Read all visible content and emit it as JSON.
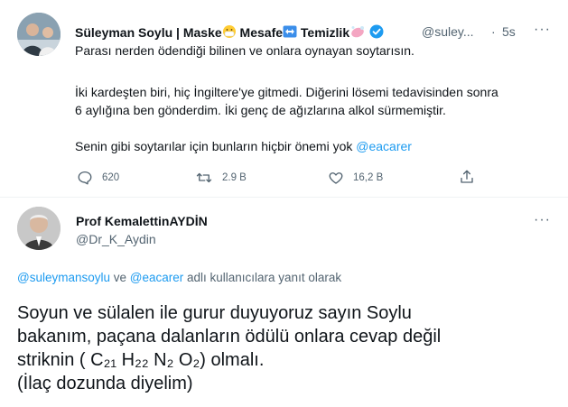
{
  "tweet1": {
    "name_part1": "Süleyman Soylu | Maske",
    "name_part2": "Mesafe",
    "name_part3": "Temizlik",
    "handle": "@suley...",
    "dot": "·",
    "time": "5s",
    "more": "···",
    "line1": "Parası nerden ödendiği bilinen ve onlara oynayan soytarısın.",
    "line2": "İki kardeşten biri, hiç İngiltere'ye gitmedi. Diğerini lösemi tedavisinden sonra",
    "line3": "6 aylığına ben gönderdim. İki genç de ağızlarına alkol sürmemiştir.",
    "line4_prefix": "Senin gibi soytarılar için bunların hiçbir önemi yok ",
    "line4_mention": "@eacarer",
    "replies": "620",
    "retweets": "2.9 B",
    "likes": "16,2 B"
  },
  "tweet2": {
    "name": "Prof KemalettinAYDİN",
    "handle": "@Dr_K_Aydin",
    "more": "···",
    "replying_mention1": "@suleymansoylu",
    "replying_ve": " ve ",
    "replying_mention2": "@eacarer",
    "replying_suffix": " adlı kullanıcılara yanıt olarak",
    "text_line1": "Soyun ve sülalen ile gurur duyuyoruz sayın Soylu",
    "text_line2": "bakanım, paçana dalanların ödülü onlara cevap değil",
    "text_line3": "striknin ( C₂₁ H₂₂ N₂ O₂) olmalı.",
    "text_line4": "(İlaç dozunda diyelim)"
  },
  "colors": {
    "accent": "#1d9bf0",
    "secondary_text": "#536471",
    "divider": "#eff3f4"
  }
}
